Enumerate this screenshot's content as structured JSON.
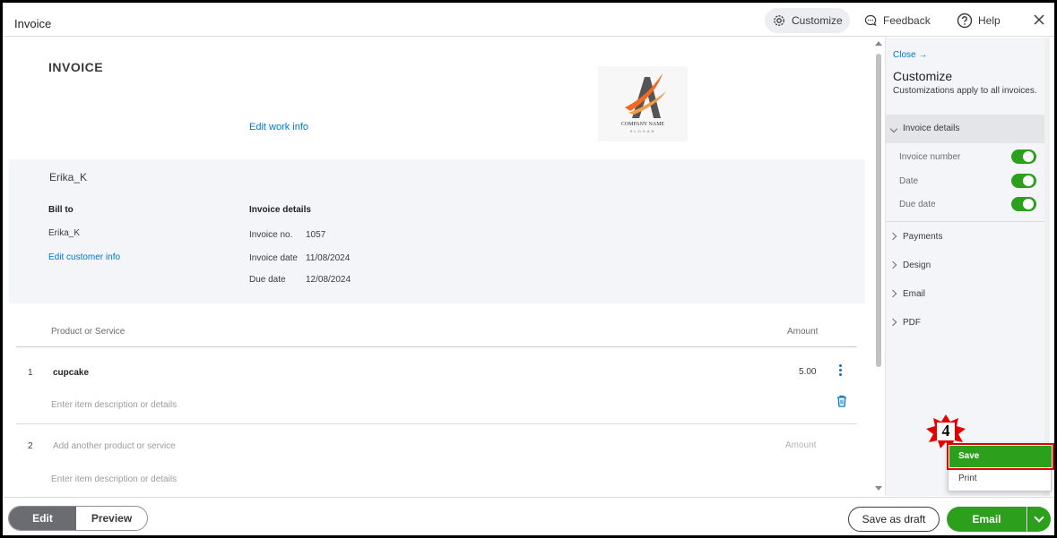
{
  "window": {
    "title": "Invoice"
  },
  "topbar": {
    "customize_label": "Customize",
    "feedback_label": "Feedback",
    "help_label": "Help"
  },
  "invoice": {
    "heading": "INVOICE",
    "edit_work_info": "Edit work info",
    "logo_caption": "COMPANY NAME",
    "logo_subcaption": "SLOGAN",
    "customer_name": "Erika_K",
    "bill_to_label": "Bill to",
    "bill_to_name": "Erika_K",
    "edit_customer_info": "Edit customer info",
    "details_label": "Invoice details",
    "details": [
      {
        "label": "Invoice no.",
        "value": "1057"
      },
      {
        "label": "Invoice date",
        "value": "11/08/2024"
      },
      {
        "label": "Due date",
        "value": "12/08/2024"
      }
    ]
  },
  "items": {
    "header_product": "Product or Service",
    "header_amount": "Amount",
    "rows": [
      {
        "num": "1",
        "product": "cupcake",
        "amount": "5.00",
        "description_placeholder": "Enter item description or details"
      },
      {
        "num": "2",
        "product_placeholder": "Add another product or service",
        "amount_placeholder": "Amount",
        "description_placeholder": "Enter item description or details"
      }
    ]
  },
  "panel": {
    "close_label": "Close →",
    "title": "Customize",
    "subtitle": "Customizations apply to all invoices.",
    "open_section": "Invoice details",
    "toggles": [
      {
        "label": "Invoice number",
        "on": true
      },
      {
        "label": "Date",
        "on": true
      },
      {
        "label": "Due date",
        "on": true
      }
    ],
    "sections": [
      "Payments",
      "Design",
      "Email",
      "PDF"
    ]
  },
  "dropdown": {
    "save_label": "Save",
    "print_label": "Print"
  },
  "annotation": {
    "step_number": "4"
  },
  "bottombar": {
    "edit_label": "Edit",
    "preview_label": "Preview",
    "save_draft_label": "Save as draft",
    "email_label": "Email"
  },
  "colors": {
    "accent_green": "#2ca01c",
    "link_blue": "#0077c5",
    "highlight_red": "#e50000"
  }
}
